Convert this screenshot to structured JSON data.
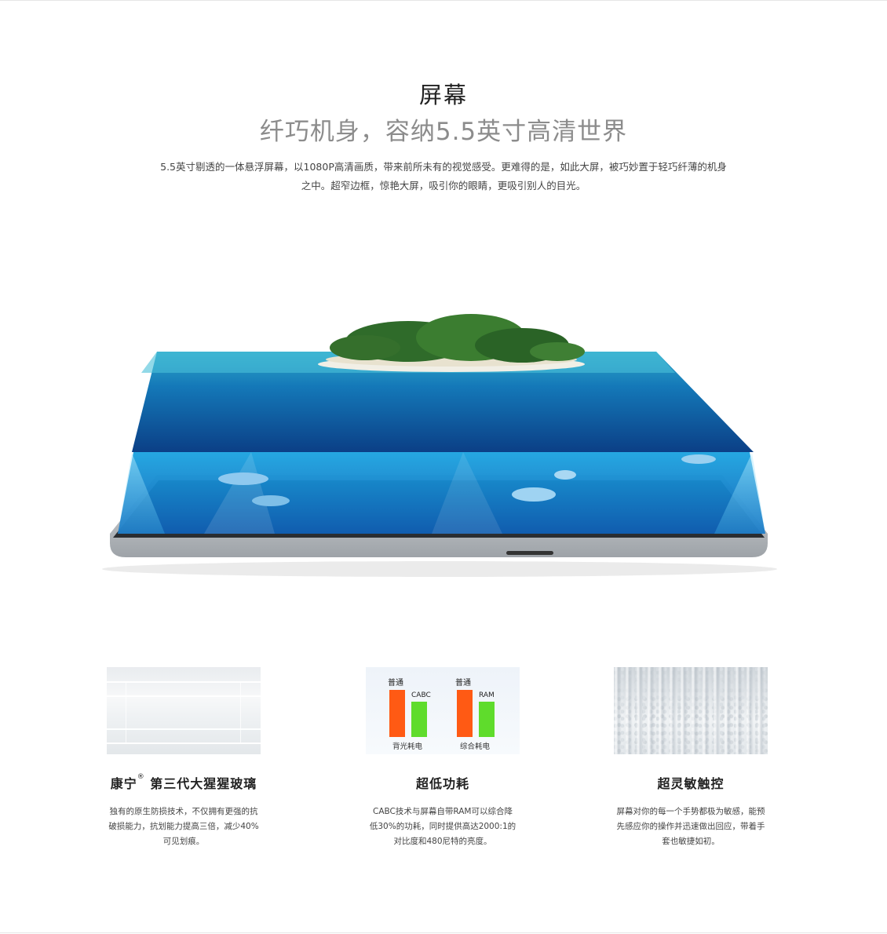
{
  "section": {
    "title": "屏幕",
    "subtitle": "纤巧机身，容纳5.5英寸高清世界",
    "description_line1": "5.5英寸剔透的一体悬浮屏幕，以1080P高清画质，带来前所未有的视觉感受。更难得的是，如此大屏，被巧妙置于轻巧纤薄的机身",
    "description_line2": "之中。超窄边框，惊艳大屏，吸引你的眼睛，更吸引别人的目光。"
  },
  "features": [
    {
      "title": "康宁",
      "title_mark": "®",
      "title_rest": " 第三代大猩猩玻璃",
      "desc_lines": [
        "独有的原生防损技术，不仅拥有更强的抗",
        "破损能力，抗划能力提高三倍，减少40%",
        "可见划痕。"
      ]
    },
    {
      "title": "超低功耗",
      "desc_lines": [
        "CABC技术与屏幕自带RAM可以综合降",
        "低30%的功耗，同时提供高达2000:1的",
        "对比度和480尼特的亮度。"
      ]
    },
    {
      "title": "超灵敏触控",
      "desc_lines": [
        "屏幕对你的每一个手势都极为敏感，能预",
        "先感应你的操作并迅速做出回应，带着手",
        "套也敏捷如初。"
      ]
    }
  ],
  "chart_data": {
    "type": "bar",
    "groups": [
      {
        "category": "背光耗电",
        "bars": [
          {
            "label": "普通",
            "value": 1.0
          },
          {
            "label": "CABC",
            "value": 0.75
          }
        ]
      },
      {
        "category": "综合耗电",
        "bars": [
          {
            "label": "普通",
            "value": 1.0
          },
          {
            "label": "RAM",
            "value": 0.75
          }
        ]
      }
    ],
    "colors": {
      "normal": "#ff5a14",
      "improved": "#5fdc2c"
    }
  }
}
